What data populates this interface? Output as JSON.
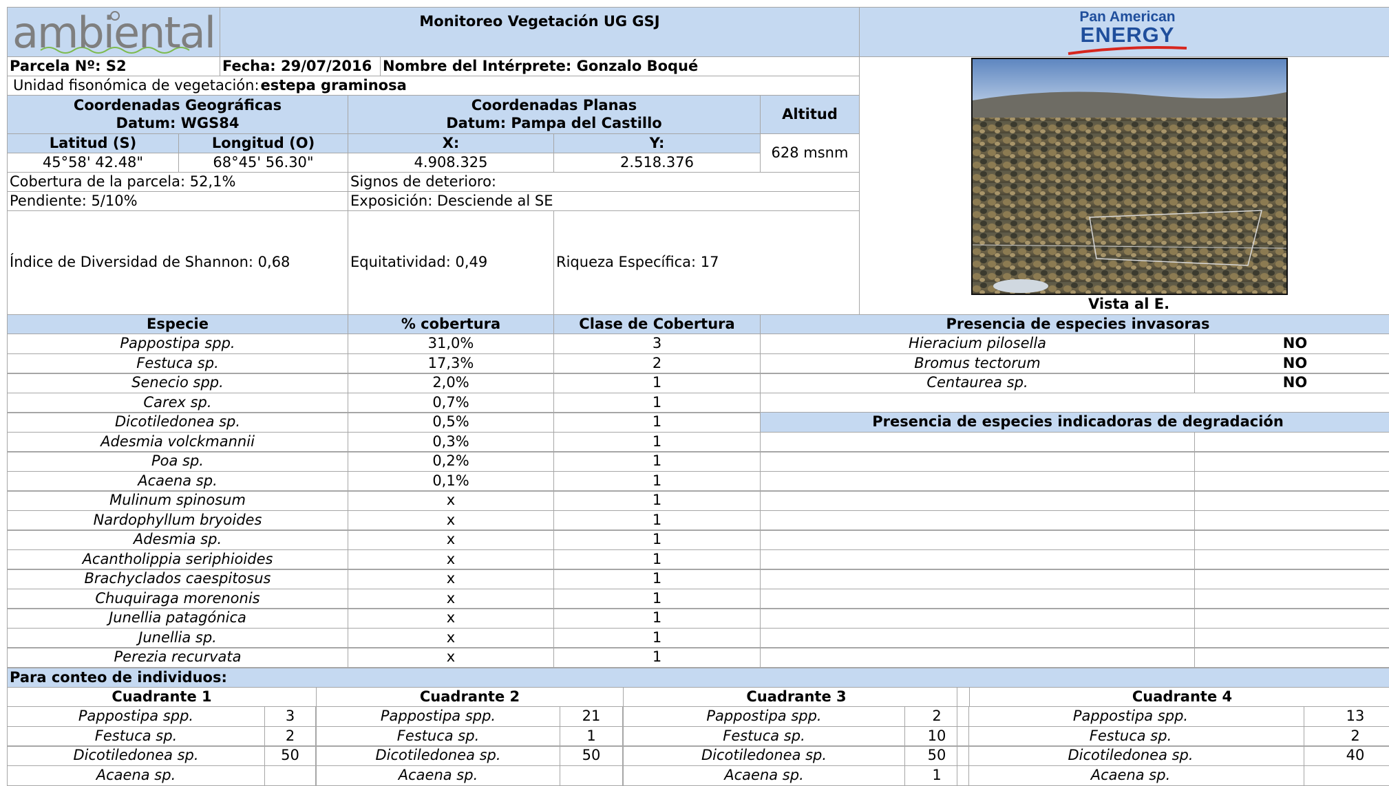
{
  "header": {
    "logo_left": "ambiental",
    "title": "Monitoreo Vegetación UG GSJ",
    "logo_right_line1": "Pan American",
    "logo_right_line2": "ENERGY"
  },
  "plot": {
    "parcela": "Parcela Nº: S2",
    "fecha": "Fecha: 29/07/2016",
    "interprete": "Nombre del Intérprete: Gonzalo Boqué",
    "unidad_label": "Unidad fisonómica de vegetación: ",
    "unidad_value": "estepa graminosa",
    "geo_title": "Coordenadas Geográficas",
    "geo_datum": "Datum: WGS84",
    "plan_title": "Coordenadas Planas",
    "plan_datum": "Datum: Pampa del Castillo",
    "altitud_label": "Altitud",
    "lat_label": "Latitud (S)",
    "lon_label": "Longitud (O)",
    "x_label": "X:",
    "y_label": "Y:",
    "lat_value": "45°58' 42.48\"",
    "lon_value": "68°45' 56.30\"",
    "x_value": "4.908.325",
    "y_value": "2.518.376",
    "altitud_value": "628 msnm",
    "cobertura": "Cobertura de la parcela: 52,1%",
    "signos": "Signos de deterioro:",
    "pendiente": "Pendiente: 5/10%",
    "exposicion": "Exposición: Desciende al SE",
    "shannon": "Índice de Diversidad de Shannon: 0,68",
    "equitatividad": "Equitatividad: 0,49",
    "riqueza": "Riqueza Específica: 17",
    "photo_caption": "Vista al E."
  },
  "species_table": {
    "headers": [
      "Especie",
      "% cobertura",
      "Clase de Cobertura"
    ],
    "rows": [
      [
        "Pappostipa spp.",
        "31,0%",
        "3"
      ],
      [
        "Festuca sp.",
        "17,3%",
        "2"
      ],
      [
        "Senecio spp.",
        "2,0%",
        "1"
      ],
      [
        "Carex sp.",
        "0,7%",
        "1"
      ],
      [
        "Dicotiledonea sp.",
        "0,5%",
        "1"
      ],
      [
        "Adesmia volckmannii",
        "0,3%",
        "1"
      ],
      [
        "Poa sp.",
        "0,2%",
        "1"
      ],
      [
        "Acaena sp.",
        "0,1%",
        "1"
      ],
      [
        "Mulinum spinosum",
        "x",
        "1"
      ],
      [
        "Nardophyllum bryoides",
        "x",
        "1"
      ],
      [
        "Adesmia sp.",
        "x",
        "1"
      ],
      [
        "Acantholippia seriphioides",
        "x",
        "1"
      ],
      [
        "Brachyclados caespitosus",
        "x",
        "1"
      ],
      [
        "Chuquiraga morenonis",
        "x",
        "1"
      ],
      [
        "Junellia patagónica",
        "x",
        "1"
      ],
      [
        "Junellia sp.",
        "x",
        "1"
      ],
      [
        "Perezia recurvata",
        "x",
        "1"
      ]
    ]
  },
  "invasive": {
    "title": "Presencia de especies invasoras",
    "rows": [
      [
        "Hieracium pilosella",
        "NO"
      ],
      [
        "Bromus tectorum",
        "NO"
      ],
      [
        "Centaurea sp.",
        "NO"
      ]
    ]
  },
  "degradation": {
    "title": "Presencia de especies indicadoras de degradación"
  },
  "count": {
    "title": "Para conteo de individuos:",
    "quadrants": [
      {
        "name": "Cuadrante 1",
        "rows": [
          [
            "Pappostipa spp.",
            "3"
          ],
          [
            "Festuca sp.",
            "2"
          ],
          [
            "Dicotiledonea sp.",
            "50"
          ],
          [
            "Acaena sp.",
            ""
          ]
        ]
      },
      {
        "name": "Cuadrante 2",
        "rows": [
          [
            "Pappostipa spp.",
            "21"
          ],
          [
            "Festuca sp.",
            "1"
          ],
          [
            "Dicotiledonea sp.",
            "50"
          ],
          [
            "Acaena sp.",
            ""
          ]
        ]
      },
      {
        "name": "Cuadrante 3",
        "rows": [
          [
            "Pappostipa spp.",
            "2"
          ],
          [
            "Festuca sp.",
            "10"
          ],
          [
            "Dicotiledonea sp.",
            "50"
          ],
          [
            "Acaena sp.",
            "1"
          ]
        ]
      },
      {
        "name": "Cuadrante 4",
        "rows": [
          [
            "Pappostipa spp.",
            "13"
          ],
          [
            "Festuca sp.",
            "2"
          ],
          [
            "Dicotiledonea sp.",
            "40"
          ],
          [
            "Acaena sp.",
            ""
          ]
        ]
      }
    ]
  },
  "colors": {
    "header_fill": "#c5d9f1",
    "grid_line": "#a6a6a6",
    "pae_blue": "#1f4e9c",
    "pae_red": "#d7261e"
  }
}
